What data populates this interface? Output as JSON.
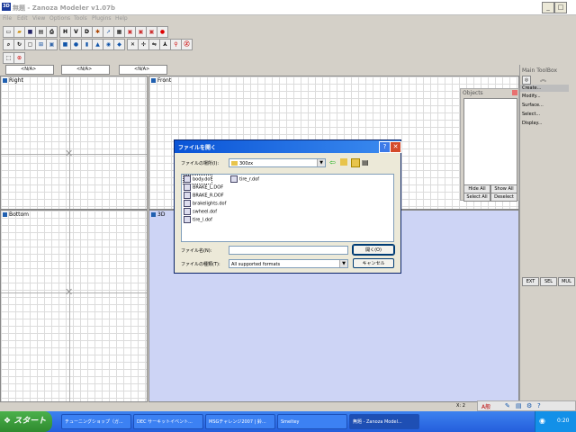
{
  "window": {
    "title": "無題 - Zanoza Modeler v1.07b",
    "icon": "3D"
  },
  "menu": [
    "File",
    "Edit",
    "View",
    "Options",
    "Tools",
    "Plugins",
    "Help"
  ],
  "toolbar1": {
    "h": "H",
    "v": "V",
    "d": "D"
  },
  "selectors": [
    "<N/A>",
    "<N/A>",
    "<N/A>"
  ],
  "viewports": {
    "right": "Right",
    "front": "Front",
    "bottom": "Bottom",
    "three_d": "3D"
  },
  "objects": {
    "title": "Objects",
    "hide_all": "Hide All",
    "show_all": "Show All",
    "select_all": "Select All",
    "deselect": "Deselect"
  },
  "toolbox": {
    "title": "Main ToolBox",
    "items": [
      "Create...",
      "Modify...",
      "Surface...",
      "Select...",
      "Display..."
    ],
    "tabs": [
      "EXT",
      "SEL",
      "MUL"
    ]
  },
  "dialog": {
    "title": "ファイルを開く",
    "help": "?",
    "look_in_label": "ファイルの場所(I):",
    "look_in_value": "300zx",
    "files": [
      "body.dof",
      "BRAKE_L.DOF",
      "BRAKE_R.DOF",
      "brakelights.dof",
      "swheel.dof",
      "tire_l.dof",
      "tire_r.dof"
    ],
    "filename_label": "ファイル名(N):",
    "filename_value": "",
    "filetype_label": "ファイルの種類(T):",
    "filetype_value": "All supported formats",
    "open_button": "開く(O)",
    "cancel_button": "キャンセル"
  },
  "status": {
    "x_label": "X: 2"
  },
  "taskbar": {
    "start": "スタート",
    "tasks": [
      "チューニングショップ（ガ...",
      "DEC サーキットイベント...",
      "MSGチャレンジ2007 | 鈴...",
      "Smeltey",
      "無題 - Zanoza Model..."
    ],
    "clock": "0:20",
    "ime": "A般"
  },
  "colors": {
    "accent": "#0a54d6",
    "viewport_3d": "#cdd4f5",
    "taskbar": "#245edc",
    "start": "#2f8a2f"
  }
}
